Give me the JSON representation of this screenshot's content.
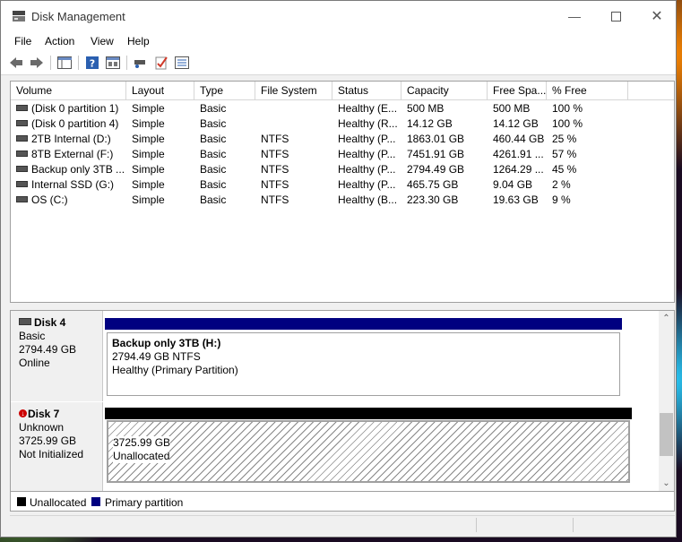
{
  "window": {
    "title": "Disk Management"
  },
  "menu": [
    "File",
    "Action",
    "View",
    "Help"
  ],
  "toolbar": {
    "icons": [
      "back-icon",
      "forward-icon",
      "console-tree-icon",
      "help-icon",
      "properties-icon",
      "rescan-icon",
      "check-icon",
      "list-icon"
    ]
  },
  "volume_table": {
    "columns": [
      "Volume",
      "Layout",
      "Type",
      "File System",
      "Status",
      "Capacity",
      "Free Spa...",
      "% Free"
    ],
    "rows": [
      [
        "(Disk 0 partition 1)",
        "Simple",
        "Basic",
        "",
        "Healthy (E...",
        "500 MB",
        "500 MB",
        "100 %"
      ],
      [
        "(Disk 0 partition 4)",
        "Simple",
        "Basic",
        "",
        "Healthy (R...",
        "14.12 GB",
        "14.12 GB",
        "100 %"
      ],
      [
        "2TB Internal (D:)",
        "Simple",
        "Basic",
        "NTFS",
        "Healthy (P...",
        "1863.01 GB",
        "460.44 GB",
        "25 %"
      ],
      [
        "8TB External (F:)",
        "Simple",
        "Basic",
        "NTFS",
        "Healthy (P...",
        "7451.91 GB",
        "4261.91 ...",
        "57 %"
      ],
      [
        "Backup only 3TB ...",
        "Simple",
        "Basic",
        "NTFS",
        "Healthy (P...",
        "2794.49 GB",
        "1264.29 ...",
        "45 %"
      ],
      [
        "Internal SSD (G:)",
        "Simple",
        "Basic",
        "NTFS",
        "Healthy (P...",
        "465.75 GB",
        "9.04 GB",
        "2 %"
      ],
      [
        "OS (C:)",
        "Simple",
        "Basic",
        "NTFS",
        "Healthy (B...",
        "223.30 GB",
        "19.63 GB",
        "9 %"
      ]
    ]
  },
  "disks": [
    {
      "name": "Disk 4",
      "type": "Basic",
      "size": "2794.49 GB",
      "state": "Online",
      "partition": {
        "title": "Backup only 3TB  (H:)",
        "line2": "2794.49 GB NTFS",
        "line3": "Healthy (Primary Partition)"
      }
    },
    {
      "name": "Disk 7",
      "type": "Unknown",
      "size": "3725.99 GB",
      "state": "Not Initialized",
      "partition": {
        "line1": "3725.99 GB",
        "line2": "Unallocated"
      }
    }
  ],
  "legend": {
    "unallocated": "Unallocated",
    "primary": "Primary partition"
  },
  "colors": {
    "unallocated": "#000000",
    "primary": "#000080",
    "accent": "#0078d7"
  }
}
